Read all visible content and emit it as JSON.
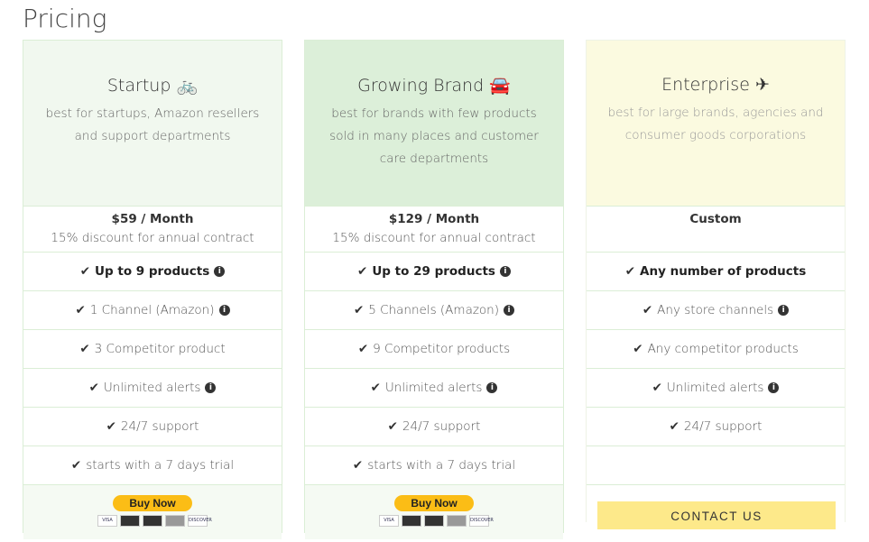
{
  "page_title": "Pricing",
  "plans": [
    {
      "name": "Startup",
      "icon": "bicycle-icon",
      "glyph": "🚲",
      "desc": "best for startups, Amazon resellers and support departments",
      "price": "$59 / Month",
      "discount": "15% discount for annual contract",
      "features": [
        {
          "text": "Up to 9 products",
          "bold": true,
          "info": true
        },
        {
          "text": "1 Channel (Amazon)",
          "info": true
        },
        {
          "text": "3 Competitor product"
        },
        {
          "text": "Unlimited alerts",
          "info": true
        },
        {
          "text": "24/7 support"
        },
        {
          "text": "starts with a 7 days trial"
        }
      ],
      "button": "Buy Now"
    },
    {
      "name": "Growing Brand",
      "icon": "car-icon",
      "glyph": "🚘",
      "desc": "best for brands with few products sold in many places and customer care departments",
      "price": "$129 / Month",
      "discount": "15% discount for annual contract",
      "features": [
        {
          "text": "Up to 29 products",
          "bold": true,
          "info": true
        },
        {
          "text": "5 Channels (Amazon)",
          "info": true
        },
        {
          "text": "9 Competitor products"
        },
        {
          "text": "Unlimited alerts",
          "info": true
        },
        {
          "text": "24/7 support"
        },
        {
          "text": "starts with a 7 days trial"
        }
      ],
      "button": "Buy Now"
    },
    {
      "name": "Enterprise",
      "icon": "plane-icon",
      "glyph": "✈",
      "desc": "best for large brands, agencies and consumer goods corporations",
      "price": "Custom",
      "discount": "",
      "features": [
        {
          "text": "Any number of products",
          "bold": true
        },
        {
          "text": "Any store channels",
          "boldprefix": "Any",
          "info": true
        },
        {
          "text": "Any competitor products"
        },
        {
          "text": "Unlimited alerts",
          "info": true
        },
        {
          "text": "24/7 support"
        },
        {
          "text": ""
        }
      ],
      "button": "CONTACT US"
    }
  ],
  "payment_cards": [
    "VISA",
    "",
    "",
    "",
    "DISCOVER"
  ]
}
